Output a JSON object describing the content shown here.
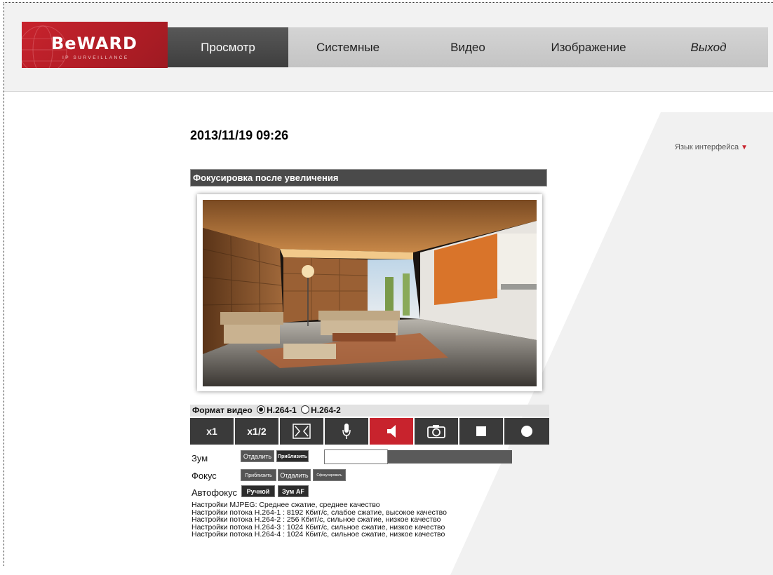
{
  "brand": {
    "logo_text": "BeWARD",
    "logo_sub": "IP SURVEILLANCE",
    "color": "#c8232d"
  },
  "nav": {
    "items": [
      {
        "label": "Просмотр",
        "active": true
      },
      {
        "label": "Системные"
      },
      {
        "label": "Видео"
      },
      {
        "label": "Изображение"
      },
      {
        "label": "Выход"
      }
    ]
  },
  "datetime": "2013/11/19 09:26",
  "language": {
    "label": "Язык интерфейса",
    "icon": "triangle-down-icon"
  },
  "section_title": "Фокусировка после увеличения",
  "video_format": {
    "label": "Формат видео",
    "options": [
      {
        "label": "H.264-1",
        "selected": true
      },
      {
        "label": "H.264-2",
        "selected": false
      }
    ]
  },
  "controls": {
    "x1": "x1",
    "x12": "x1/2",
    "fullscreen_icon": "fullscreen-icon",
    "mic_icon": "microphone-icon",
    "speaker_icon": "speaker-icon",
    "snapshot_icon": "camera-icon",
    "stop_icon": "stop-icon",
    "record_icon": "record-icon"
  },
  "zoom": {
    "label": "Зум",
    "zoom_out": "Отдалить",
    "zoom_in": "Приблизить"
  },
  "focus": {
    "label": "Фокус",
    "near": "Приблизить",
    "far": "Отдалить",
    "auto": "Сфокусировать"
  },
  "autofocus": {
    "label": "Автофокус",
    "manual": "Ручной",
    "zoom_af": "Зум AF"
  },
  "stream_info": [
    "Настройки MJPEG: Среднее сжатие, среднее качество",
    "Настройки потока H.264-1 : 8192 Кбит/с, слабое сжатие, высокое качество",
    "Настройки потока H.264-2 : 256 Кбит/с, сильное сжатие, низкое качество",
    "Настройки потока H.264-3 : 1024 Кбит/с, сильное сжатие, низкое качество",
    "Настройки потока H.264-4 : 1024 Кбит/с, сильное сжатие, низкое качество"
  ]
}
